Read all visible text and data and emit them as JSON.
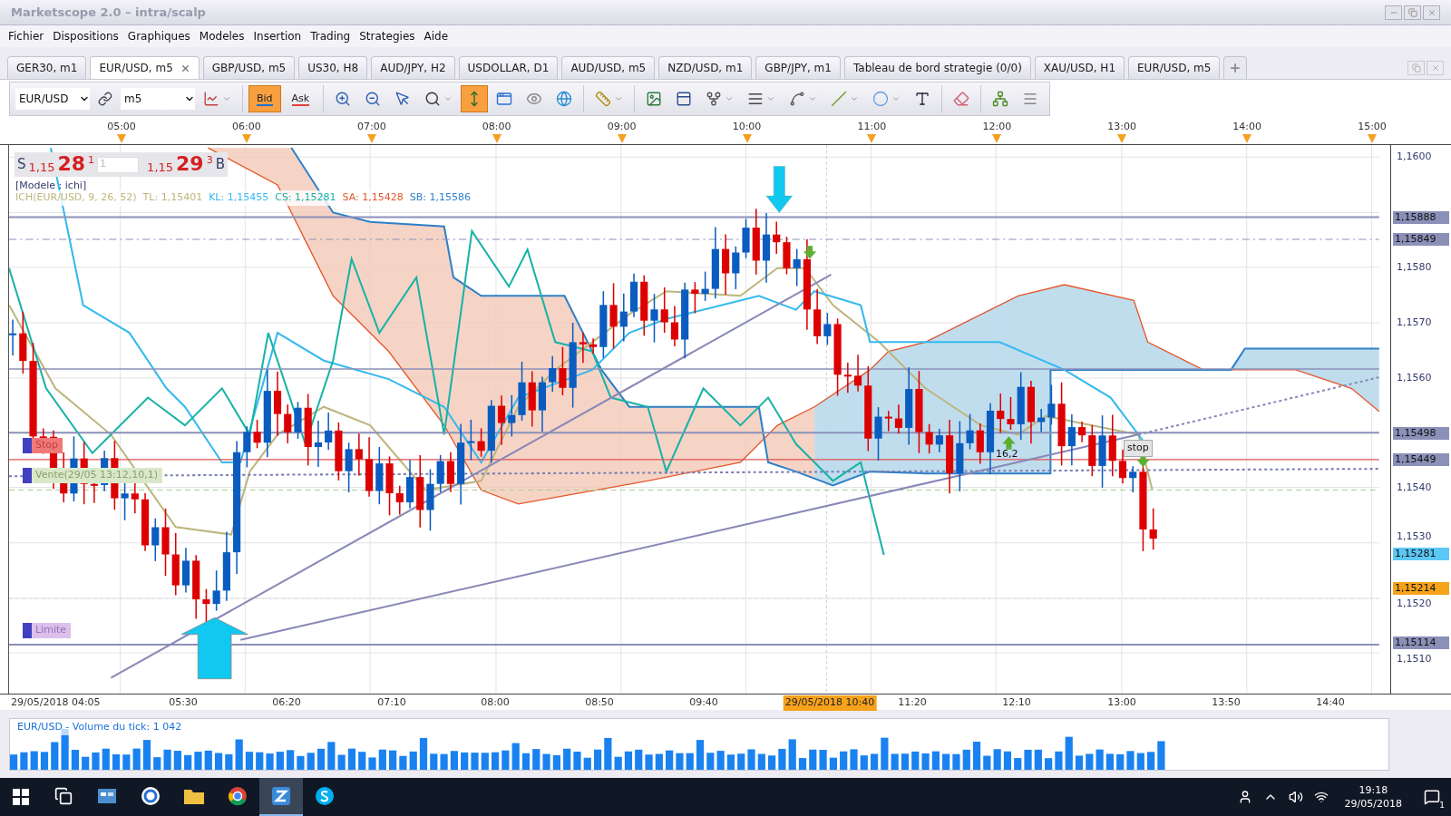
{
  "window": {
    "title": "Marketscope 2.0 – intra/scalp"
  },
  "menu": [
    "Fichier",
    "Dispositions",
    "Graphiques",
    "Modeles",
    "Insertion",
    "Trading",
    "Strategies",
    "Aide"
  ],
  "tabs": [
    {
      "label": "GER30, m1",
      "selected": false
    },
    {
      "label": "EUR/USD, m5",
      "selected": true
    },
    {
      "label": "GBP/USD, m5",
      "selected": false
    },
    {
      "label": "US30, H8",
      "selected": false
    },
    {
      "label": "AUD/JPY, H2",
      "selected": false
    },
    {
      "label": "USDOLLAR, D1",
      "selected": false
    },
    {
      "label": "AUD/USD, m5",
      "selected": false
    },
    {
      "label": "NZD/USD, m1",
      "selected": false
    },
    {
      "label": "GBP/JPY, m1",
      "selected": false
    },
    {
      "label": "Tableau de bord strategie (0/0)",
      "selected": false
    },
    {
      "label": "XAU/USD, H1",
      "selected": false
    },
    {
      "label": "EUR/USD, m5",
      "selected": false
    }
  ],
  "toolbar": {
    "symbol": "EUR/USD",
    "timeframe": "m5",
    "tools": [
      {
        "kind": "chart-type",
        "active": false,
        "dropdown": true
      },
      {
        "kind": "separator"
      },
      {
        "kind": "text",
        "label": "Bid",
        "color": "#1e6fd0",
        "active": true
      },
      {
        "kind": "text",
        "label": "Ask",
        "color": "#e04040",
        "active": false
      },
      {
        "kind": "separator"
      },
      {
        "kind": "zoom-in",
        "active": false,
        "dropdown": false
      },
      {
        "kind": "zoom-out",
        "active": false,
        "dropdown": false
      },
      {
        "kind": "zoom-cursor",
        "active": false,
        "dropdown": false
      },
      {
        "kind": "zoom-range",
        "active": false,
        "dropdown": true
      },
      {
        "kind": "autoscroll",
        "active": true,
        "dropdown": false
      },
      {
        "kind": "properties",
        "active": false,
        "dropdown": false
      },
      {
        "kind": "eye",
        "active": false,
        "dropdown": false
      },
      {
        "kind": "globe",
        "active": false,
        "dropdown": false
      },
      {
        "kind": "separator"
      },
      {
        "kind": "ruler",
        "active": false,
        "dropdown": true
      },
      {
        "kind": "separator"
      },
      {
        "kind": "picture",
        "active": false,
        "dropdown": false
      },
      {
        "kind": "window",
        "active": false,
        "dropdown": false
      },
      {
        "kind": "fork",
        "active": false,
        "dropdown": true
      },
      {
        "kind": "lines",
        "active": false,
        "dropdown": true
      },
      {
        "kind": "fan",
        "active": false,
        "dropdown": true
      },
      {
        "kind": "line",
        "active": false,
        "dropdown": true
      },
      {
        "kind": "ellipse",
        "active": false,
        "dropdown": true
      },
      {
        "kind": "add-text",
        "active": false,
        "dropdown": false
      },
      {
        "kind": "separator"
      },
      {
        "kind": "eraser",
        "active": false,
        "dropdown": false
      },
      {
        "kind": "separator"
      },
      {
        "kind": "tree",
        "active": false,
        "dropdown": false
      },
      {
        "kind": "more",
        "active": false,
        "dropdown": false
      }
    ]
  },
  "chart": {
    "top_axis": [
      "05:00",
      "06:00",
      "07:00",
      "08:00",
      "09:00",
      "10:00",
      "11:00",
      "12:00",
      "13:00",
      "14:00",
      "15:00"
    ],
    "quote": {
      "sell_label": "S",
      "sell_prefix": "1,15",
      "sell_big": "28",
      "sell_sup": "1",
      "amount": "1",
      "buy_prefix": "1,15",
      "buy_big": "29",
      "buy_sup": "3",
      "buy_label": "B"
    },
    "template": "[Modele : ichi]",
    "indicator": [
      {
        "text": "ICH(EUR/USD, 9, 26, 52)",
        "color": "#bdb57e"
      },
      {
        "text": "TL: 1,15401",
        "color": "#bdb57e"
      },
      {
        "text": "KL: 1,15455",
        "color": "#35b9ee"
      },
      {
        "text": "CS: 1,15281",
        "color": "#19b2a6"
      },
      {
        "text": "SA: 1,15428",
        "color": "#e4572a"
      },
      {
        "text": "SB: 1,15586",
        "color": "#2f80c8"
      }
    ],
    "orders": [
      {
        "label": "Stop",
        "kind": "stop"
      },
      {
        "label": "Vente(29/05 13:12,10,1)",
        "kind": "entry"
      },
      {
        "label": "Limite",
        "kind": "limit"
      }
    ],
    "annotations": [
      {
        "text": "16,2",
        "kind": "plain"
      },
      {
        "text": "stop",
        "kind": "tag"
      }
    ],
    "price_ticks": [
      "1,1600",
      "1,1580",
      "1,1570",
      "1,1560",
      "1,1540",
      "1,1530",
      "1,1520",
      "1,1510"
    ],
    "price_markers": [
      {
        "text": "1,15888",
        "color": "#8b90b8"
      },
      {
        "text": "1,15849",
        "color": "#8b90b8"
      },
      {
        "text": "1,15498",
        "color": "#8b90b8"
      },
      {
        "text": "1,15449",
        "color": "#8b90b8"
      },
      {
        "text": "1,15281",
        "color": "#5cc8f5"
      },
      {
        "text": "1,15214",
        "color": "#f7a21b"
      },
      {
        "text": "1,15114",
        "color": "#8b90b8"
      }
    ],
    "bottom_axis": [
      {
        "text": "29/05/2018 04:05",
        "highlighted": false
      },
      {
        "text": "05:30",
        "highlighted": false
      },
      {
        "text": "06:20",
        "highlighted": false
      },
      {
        "text": "07:10",
        "highlighted": false
      },
      {
        "text": "08:00",
        "highlighted": false
      },
      {
        "text": "08:50",
        "highlighted": false
      },
      {
        "text": "09:40",
        "highlighted": false
      },
      {
        "text": "29/05/2018 10:40",
        "highlighted": true
      },
      {
        "text": "11:20",
        "highlighted": false
      },
      {
        "text": "12:10",
        "highlighted": false
      },
      {
        "text": "13:00",
        "highlighted": false
      },
      {
        "text": "13:50",
        "highlighted": false
      },
      {
        "text": "14:40",
        "highlighted": false
      }
    ]
  },
  "volume": {
    "label": "EUR/USD - Volume du tick: 1 042"
  },
  "taskbar": {
    "apps": [
      {
        "kind": "task-view",
        "selected": false
      },
      {
        "kind": "store",
        "selected": false
      },
      {
        "kind": "browser-g",
        "selected": false
      },
      {
        "kind": "folder",
        "selected": false
      },
      {
        "kind": "chrome",
        "selected": false
      },
      {
        "kind": "marketscope",
        "selected": true
      },
      {
        "kind": "skype",
        "selected": false
      }
    ],
    "time": "19:18",
    "date": "29/05/2018",
    "notifications": "1"
  }
}
